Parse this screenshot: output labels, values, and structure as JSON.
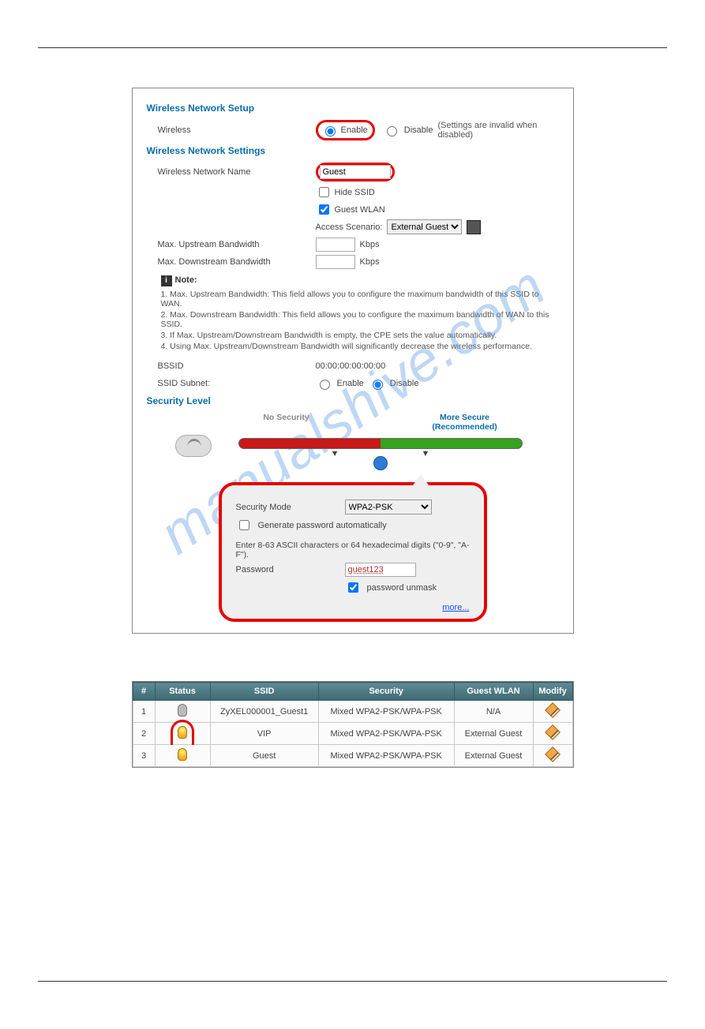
{
  "watermark": "manualshive.com",
  "setup": {
    "title": "Wireless Network Setup",
    "wireless_label": "Wireless",
    "enable_label": "Enable",
    "disable_label": "Disable",
    "disable_hint": "(Settings are invalid when disabled)"
  },
  "settings": {
    "title": "Wireless Network Settings",
    "name_label": "Wireless Network Name",
    "name_value": "Guest",
    "hide_ssid_label": "Hide SSID",
    "guest_wlan_label": "Guest WLAN",
    "access_scenario_label": "Access Scenario:",
    "access_scenario_value": "External Guest",
    "max_up_label": "Max. Upstream Bandwidth",
    "max_down_label": "Max. Downstream Bandwidth",
    "kbps": "Kbps"
  },
  "note_title": "Note:",
  "notes": [
    "1. Max. Upstream Bandwidth: This field allows you to configure the maximum bandwidth of this SSID to WAN.",
    "2. Max. Downstream Bandwidth: This field allows you to configure the maximum bandwidth of WAN to this SSID.",
    "3. If Max. Upstream/Downstream Bandwidth is empty, the CPE sets the value automatically.",
    "4. Using Max. Upstream/Downstream Bandwidth will significantly decrease the wireless performance."
  ],
  "bssid_label": "BSSID",
  "bssid_value": "00:00:00:00:00:00",
  "ssid_subnet_label": "SSID Subnet:",
  "subnet_enable": "Enable",
  "subnet_disable": "Disable",
  "security": {
    "title": "Security Level",
    "no_security": "No Security",
    "more_secure": "More Secure",
    "recommended": "(Recommended)",
    "mode_label": "Security Mode",
    "mode_value": "WPA2-PSK",
    "gen_auto": "Generate password automatically",
    "pw_hint": "Enter 8-63 ASCII characters or 64 hexadecimal digits (\"0-9\", \"A-F\").",
    "pw_label": "Password",
    "pw_value": "guest123",
    "unmask": "password unmask",
    "more": "more..."
  },
  "table": {
    "headers": {
      "num": "#",
      "status": "Status",
      "ssid": "SSID",
      "security": "Security",
      "guest": "Guest WLAN",
      "modify": "Modify"
    },
    "rows": [
      {
        "num": "1",
        "ssid": "ZyXEL000001_Guest1",
        "security": "Mixed WPA2-PSK/WPA-PSK",
        "guest": "N/A"
      },
      {
        "num": "2",
        "ssid": "VIP",
        "security": "Mixed WPA2-PSK/WPA-PSK",
        "guest": "External Guest"
      },
      {
        "num": "3",
        "ssid": "Guest",
        "security": "Mixed WPA2-PSK/WPA-PSK",
        "guest": "External Guest"
      }
    ]
  }
}
